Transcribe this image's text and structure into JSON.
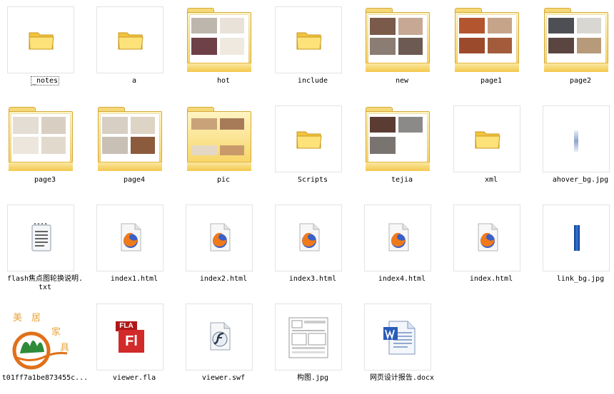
{
  "items": [
    {
      "label": "_notes",
      "selected": true,
      "icon": "folder-icon"
    },
    {
      "label": "a",
      "icon": "folder-icon"
    },
    {
      "label": "hot",
      "icon": "folder-preview-icon"
    },
    {
      "label": "include",
      "icon": "folder-icon"
    },
    {
      "label": "new",
      "icon": "folder-preview-icon"
    },
    {
      "label": "page1",
      "icon": "folder-preview-icon"
    },
    {
      "label": "page2",
      "icon": "folder-preview-icon"
    },
    {
      "label": "page3",
      "icon": "folder-preview-icon"
    },
    {
      "label": "page4",
      "icon": "folder-preview-icon"
    },
    {
      "label": "pic",
      "icon": "folder-preview-icon"
    },
    {
      "label": "Scripts",
      "icon": "folder-icon"
    },
    {
      "label": "tejia",
      "icon": "folder-preview-icon"
    },
    {
      "label": "xml",
      "icon": "folder-icon"
    },
    {
      "label": "ahover_bg.jpg",
      "icon": "image-thumbnail"
    },
    {
      "label": "flash焦点图轮换说明.\ntxt",
      "icon": "text-file-icon"
    },
    {
      "label": "index1.html",
      "icon": "firefox-html-icon"
    },
    {
      "label": "index2.html",
      "icon": "firefox-html-icon"
    },
    {
      "label": "index3.html",
      "icon": "firefox-html-icon"
    },
    {
      "label": "index4.html",
      "icon": "firefox-html-icon"
    },
    {
      "label": "index.html",
      "icon": "firefox-html-icon"
    },
    {
      "label": "link_bg.jpg",
      "icon": "image-thumbnail"
    },
    {
      "label": "t01ff7a1be873455c...",
      "icon": "logo-image-thumbnail"
    },
    {
      "label": "viewer.fla",
      "icon": "flash-fla-icon"
    },
    {
      "label": "viewer.swf",
      "icon": "flash-swf-icon"
    },
    {
      "label": "构图.jpg",
      "icon": "image-thumbnail"
    },
    {
      "label": "网页设计报告.docx",
      "icon": "word-docx-icon"
    }
  ],
  "logo_text": {
    "c1": "美",
    "c2": "居",
    "c3": "家",
    "c4": "具"
  },
  "fla_badge": "FLA",
  "fla_letters": "Fl",
  "colors": {
    "folder": "#f6d05a",
    "folder_border": "#d6a938",
    "thumb_border": "#e3e3e3"
  }
}
